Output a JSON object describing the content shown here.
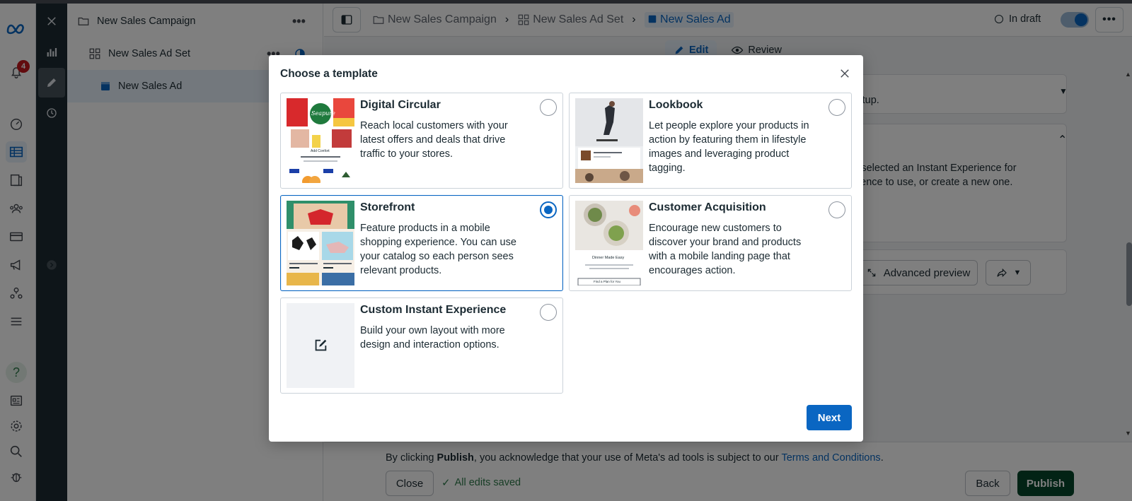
{
  "left_rail": {
    "notification_count": "4",
    "icons": [
      "meta-logo",
      "bell",
      "dashboard",
      "table",
      "pages",
      "audiences",
      "billing",
      "campaigns",
      "network",
      "menu",
      "help",
      "reports",
      "settings",
      "search",
      "debug"
    ]
  },
  "tree": {
    "campaign": "New Sales Campaign",
    "ad_set": "New Sales Ad Set",
    "ad": "New Sales Ad"
  },
  "breadcrumbs": [
    "New Sales Campaign",
    "New Sales Ad Set",
    "New Sales Ad"
  ],
  "status": {
    "label": "In draft"
  },
  "tabs": {
    "edit": "Edit",
    "review": "Review"
  },
  "background": {
    "setup_text": "nded setup.",
    "ie_line1": "haven't selected an Instant Experience for",
    "ie_line2": "t Experience to use, or create a new one.",
    "advanced_preview": "Advanced preview"
  },
  "footer": {
    "notice_prefix": "By clicking ",
    "notice_bold": "Publish",
    "notice_mid": ", you acknowledge that your use of Meta's ad tools is subject to our ",
    "notice_link": "Terms and Conditions",
    "notice_end": ".",
    "close": "Close",
    "saved": "All edits saved",
    "back": "Back",
    "publish": "Publish"
  },
  "modal": {
    "title": "Choose a template",
    "next": "Next",
    "options": [
      {
        "title": "Digital Circular",
        "desc": "Reach local customers with your latest offers and deals that drive traffic to your stores.",
        "selected": false
      },
      {
        "title": "Lookbook",
        "desc": "Let people explore your products in action by featuring them in lifestyle images and leveraging product tagging.",
        "selected": false
      },
      {
        "title": "Storefront",
        "desc": "Feature products in a mobile shopping experience. You can use your catalog so each person sees relevant products.",
        "selected": true
      },
      {
        "title": "Customer Acquisition",
        "desc": "Encourage new customers to discover your brand and products with a mobile landing page that encourages action.",
        "selected": false
      },
      {
        "title": "Custom Instant Experience",
        "desc": "Build your own layout with more design and interaction options.",
        "selected": false
      }
    ],
    "thumbs": {
      "circular_brand": "Seapure",
      "circular_caption": "Add Confort",
      "acq_caption": "Dinner Made Easy",
      "acq_button": "Find a Plan for You"
    }
  },
  "colors": {
    "accent": "#0a66c2",
    "publish": "#05472a",
    "rail_dark": "#1c2b33"
  }
}
